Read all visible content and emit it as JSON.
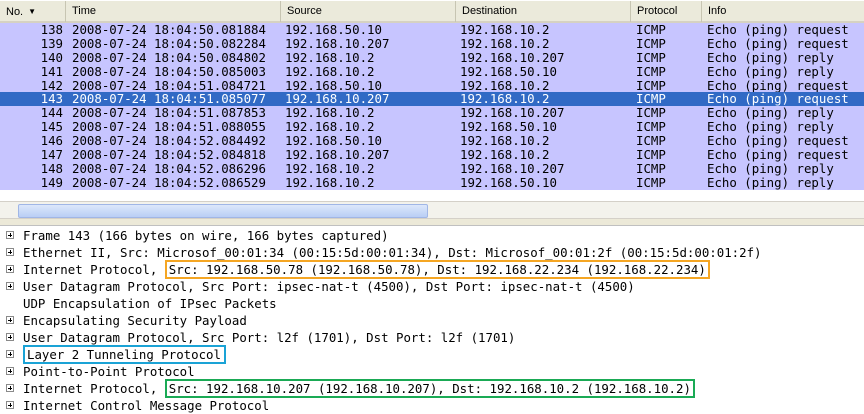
{
  "packet_list": {
    "columns": [
      "No.",
      "Time",
      "Source",
      "Destination",
      "Protocol",
      "Info"
    ],
    "sort_indicator": "▼",
    "rows": [
      {
        "no": "138",
        "time": "2008-07-24 18:04:50.081884",
        "src": "192.168.50.10",
        "dst": "192.168.10.2",
        "proto": "ICMP",
        "info": "Echo (ping) request"
      },
      {
        "no": "139",
        "time": "2008-07-24 18:04:50.082284",
        "src": "192.168.10.207",
        "dst": "192.168.10.2",
        "proto": "ICMP",
        "info": "Echo (ping) request"
      },
      {
        "no": "140",
        "time": "2008-07-24 18:04:50.084802",
        "src": "192.168.10.2",
        "dst": "192.168.10.207",
        "proto": "ICMP",
        "info": "Echo (ping) reply"
      },
      {
        "no": "141",
        "time": "2008-07-24 18:04:50.085003",
        "src": "192.168.10.2",
        "dst": "192.168.50.10",
        "proto": "ICMP",
        "info": "Echo (ping) reply"
      },
      {
        "no": "142",
        "time": "2008-07-24 18:04:51.084721",
        "src": "192.168.50.10",
        "dst": "192.168.10.2",
        "proto": "ICMP",
        "info": "Echo (ping) request"
      },
      {
        "no": "143",
        "time": "2008-07-24 18:04:51.085077",
        "src": "192.168.10.207",
        "dst": "192.168.10.2",
        "proto": "ICMP",
        "info": "Echo (ping) request",
        "selected": true
      },
      {
        "no": "144",
        "time": "2008-07-24 18:04:51.087853",
        "src": "192.168.10.2",
        "dst": "192.168.10.207",
        "proto": "ICMP",
        "info": "Echo (ping) reply"
      },
      {
        "no": "145",
        "time": "2008-07-24 18:04:51.088055",
        "src": "192.168.10.2",
        "dst": "192.168.50.10",
        "proto": "ICMP",
        "info": "Echo (ping) reply"
      },
      {
        "no": "146",
        "time": "2008-07-24 18:04:52.084492",
        "src": "192.168.50.10",
        "dst": "192.168.10.2",
        "proto": "ICMP",
        "info": "Echo (ping) request"
      },
      {
        "no": "147",
        "time": "2008-07-24 18:04:52.084818",
        "src": "192.168.10.207",
        "dst": "192.168.10.2",
        "proto": "ICMP",
        "info": "Echo (ping) request"
      },
      {
        "no": "148",
        "time": "2008-07-24 18:04:52.086296",
        "src": "192.168.10.2",
        "dst": "192.168.10.207",
        "proto": "ICMP",
        "info": "Echo (ping) reply"
      },
      {
        "no": "149",
        "time": "2008-07-24 18:04:52.086529",
        "src": "192.168.10.2",
        "dst": "192.168.50.10",
        "proto": "ICMP",
        "info": "Echo (ping) reply"
      }
    ],
    "row_color": "#c7c5ff",
    "selected_color": "#316ac5"
  },
  "details": {
    "frame": "Frame 143 (166 bytes on wire, 166 bytes captured)",
    "ethernet": "Ethernet II, Src: Microsof_00:01:34 (00:15:5d:00:01:34), Dst: Microsof_00:01:2f (00:15:5d:00:01:2f)",
    "ip_outer_prefix": "Internet Protocol, ",
    "ip_outer_highlight": "Src: 192.168.50.78 (192.168.50.78), Dst: 192.168.22.234 (192.168.22.234)",
    "udp_outer": "User Datagram Protocol, Src Port: ipsec-nat-t (4500), Dst Port: ipsec-nat-t (4500)",
    "udp_encap": "UDP Encapsulation of IPsec Packets",
    "esp": "Encapsulating Security Payload",
    "udp_inner": "User Datagram Protocol, Src Port: l2f (1701), Dst Port: l2f (1701)",
    "l2tp": "Layer 2 Tunneling Protocol",
    "ppp": "Point-to-Point Protocol",
    "ip_inner_prefix": "Internet Protocol, ",
    "ip_inner_highlight": "Src: 192.168.10.207 (192.168.10.207), Dst: 192.168.10.2 (192.168.10.2)",
    "icmp": "Internet Control Message Protocol"
  },
  "highlight_colors": {
    "orange": "#f5a623",
    "blue": "#1aa3d6",
    "green": "#1aaa55"
  }
}
